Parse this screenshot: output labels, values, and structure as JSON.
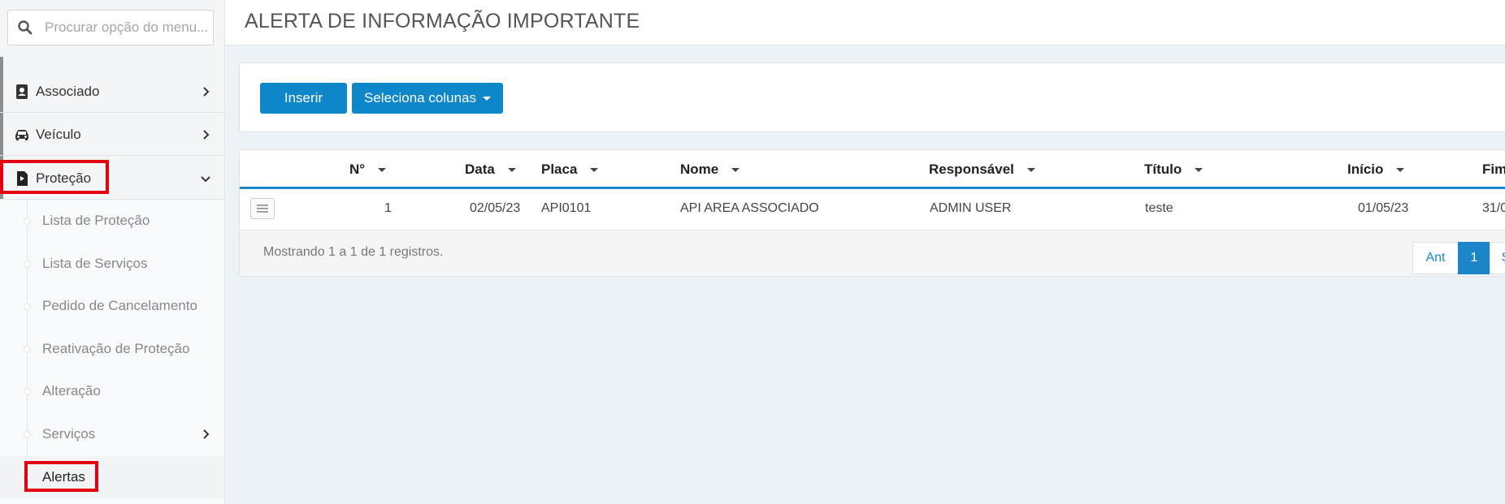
{
  "search": {
    "placeholder": "Procurar opção do menu..."
  },
  "sidebar": {
    "items": [
      {
        "label": "Associado"
      },
      {
        "label": "Veículo"
      },
      {
        "label": "Proteção"
      }
    ],
    "submenu": [
      {
        "label": "Lista de Proteção"
      },
      {
        "label": "Lista de Serviços"
      },
      {
        "label": "Pedido de Cancelamento"
      },
      {
        "label": "Reativação de Proteção"
      },
      {
        "label": "Alteração"
      },
      {
        "label": "Serviços"
      },
      {
        "label": "Alertas"
      }
    ]
  },
  "header": {
    "title": "ALERTA DE INFORMAÇÃO IMPORTANTE"
  },
  "toolbar": {
    "insert_label": "Inserir",
    "columns_label": "Seleciona colunas"
  },
  "table": {
    "columns": [
      "N°",
      "Data",
      "Placa",
      "Nome",
      "Responsável",
      "Título",
      "Início",
      "Fim"
    ],
    "rows": [
      [
        "1",
        "02/05/23",
        "API0101",
        "API AREA ASSOCIADO",
        "ADMIN USER",
        "teste",
        "01/05/23",
        "31/0"
      ]
    ]
  },
  "footer": {
    "info": "Mostrando 1 a 1 de 1 registros."
  },
  "pagination": {
    "prev": "Ant",
    "current": "1",
    "next": "S"
  },
  "colors": {
    "primary": "#0d87c9",
    "highlight": "#e3000f"
  },
  "icons": [
    "search-icon",
    "id-card-icon",
    "car-icon",
    "document-icon",
    "chevron-right-icon",
    "chevron-down-icon",
    "hamburger-icon",
    "caret-down-icon"
  ]
}
